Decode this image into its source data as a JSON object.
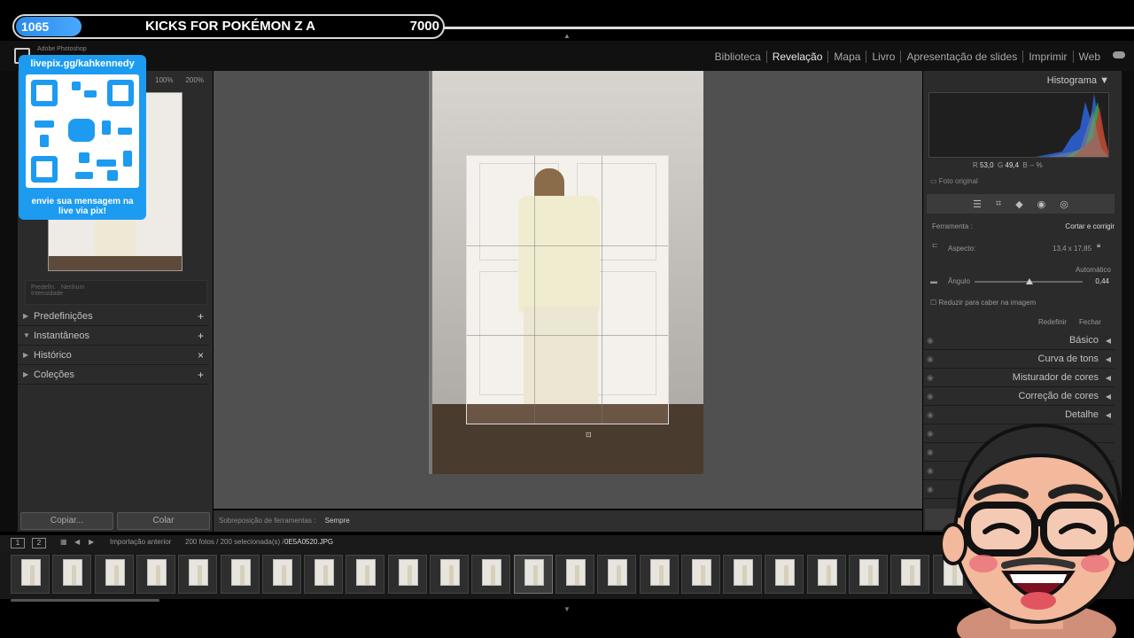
{
  "overlay": {
    "goal_count": "1065",
    "goal_title": "KICKS FOR POKÉMON Z A",
    "goal_target": "7000",
    "qr_header": "livepix.gg/kahkennedy",
    "qr_footer_1": "envie sua mensagem na",
    "qr_footer_2": "live via pix!"
  },
  "app": {
    "brand": "Adobe Photoshop",
    "modules": [
      "Biblioteca",
      "Revelação",
      "Mapa",
      "Livro",
      "Apresentação de slides",
      "Imprimir",
      "Web"
    ],
    "active_module": "Revelação"
  },
  "navigator": {
    "zoom_options": [
      "100%",
      "200%"
    ],
    "preset_label": "Predefin.",
    "preset_value": "Nenhum",
    "intensity_label": "Intensidade"
  },
  "left_sections": [
    {
      "label": "Predefinições",
      "action": "+",
      "expanded": false
    },
    {
      "label": "Instantâneos",
      "action": "+",
      "expanded": true
    },
    {
      "label": "Histórico",
      "action": "×",
      "expanded": false
    },
    {
      "label": "Coleções",
      "action": "+",
      "expanded": false
    }
  ],
  "left_buttons": {
    "copy": "Copiar...",
    "paste": "Colar"
  },
  "toolbar": {
    "overlay_label": "Sobreposição de ferramentas :",
    "overlay_value": "Sempre"
  },
  "right_panel": {
    "histogram_title": "Histograma",
    "hist_r_label": "R",
    "hist_r": "53,0",
    "hist_g_label": "G",
    "hist_g": "49,4",
    "hist_b_label": "B",
    "hist_b": "-- %",
    "original_photo": "Foto original",
    "tool_label": "Ferramenta :",
    "tool_value": "Cortar e corrigir",
    "aspect_label": "Aspecto:",
    "aspect_value": "13,4 x 17,85",
    "auto_label": "Automático",
    "angle_label": "Ângulo",
    "angle_value": "0,44",
    "constrain_label": "Reduzir para caber na imagem",
    "reset_label": "Redefinir",
    "close_label": "Fechar",
    "sections": [
      "Básico",
      "Curva de tons",
      "Misturador de cores",
      "Correção de cores",
      "Detalhe"
    ]
  },
  "filmstrip": {
    "page1": "1",
    "page2": "2",
    "source": "Importação anterior",
    "count": "200 fotos / 200 selecionada(s) /",
    "filename": "0E5A0520.JPG",
    "thumb_count": 24,
    "selected_index": 12
  }
}
